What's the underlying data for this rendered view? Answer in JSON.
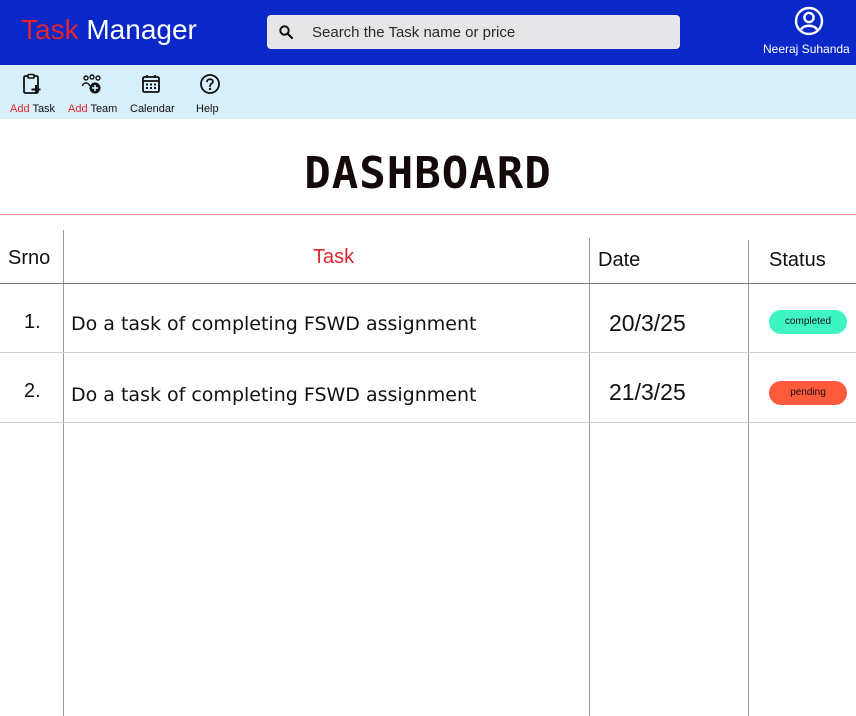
{
  "header": {
    "brand_part1": "Task",
    "brand_part2": "Manager",
    "search_placeholder": "Search the Task name or price",
    "search_icon": "search-icon",
    "user_name": "Neeraj Suhanda",
    "user_icon": "account-circle-icon",
    "colors": {
      "bar": "#0a28c7",
      "brand_accent": "#e0262e"
    }
  },
  "toolbar": {
    "items": [
      {
        "icon": "clipboard-add-icon",
        "label_prefix": "Add",
        "label": "Task"
      },
      {
        "icon": "add-team-icon",
        "label_prefix": "Add",
        "label": "Team"
      },
      {
        "icon": "calendar-icon",
        "label_prefix": "",
        "label": "Calendar"
      },
      {
        "icon": "help-icon",
        "label_prefix": "",
        "label": "Help"
      }
    ],
    "colors": {
      "bar": "#d7f0fb"
    }
  },
  "page": {
    "title": "DASHBOARD"
  },
  "table": {
    "columns": [
      "Srno",
      "Task",
      "Date",
      "Status"
    ],
    "rows": [
      {
        "srno": "1.",
        "task": "Do a task of completing FSWD assignment",
        "date": "20/3/25",
        "status": "completed"
      },
      {
        "srno": "2.",
        "task": "Do a task of completing FSWD assignment",
        "date": "21/3/25",
        "status": "pending"
      }
    ],
    "status_colors": {
      "completed": "#3ff5c4",
      "pending": "#ff5a3c"
    }
  }
}
